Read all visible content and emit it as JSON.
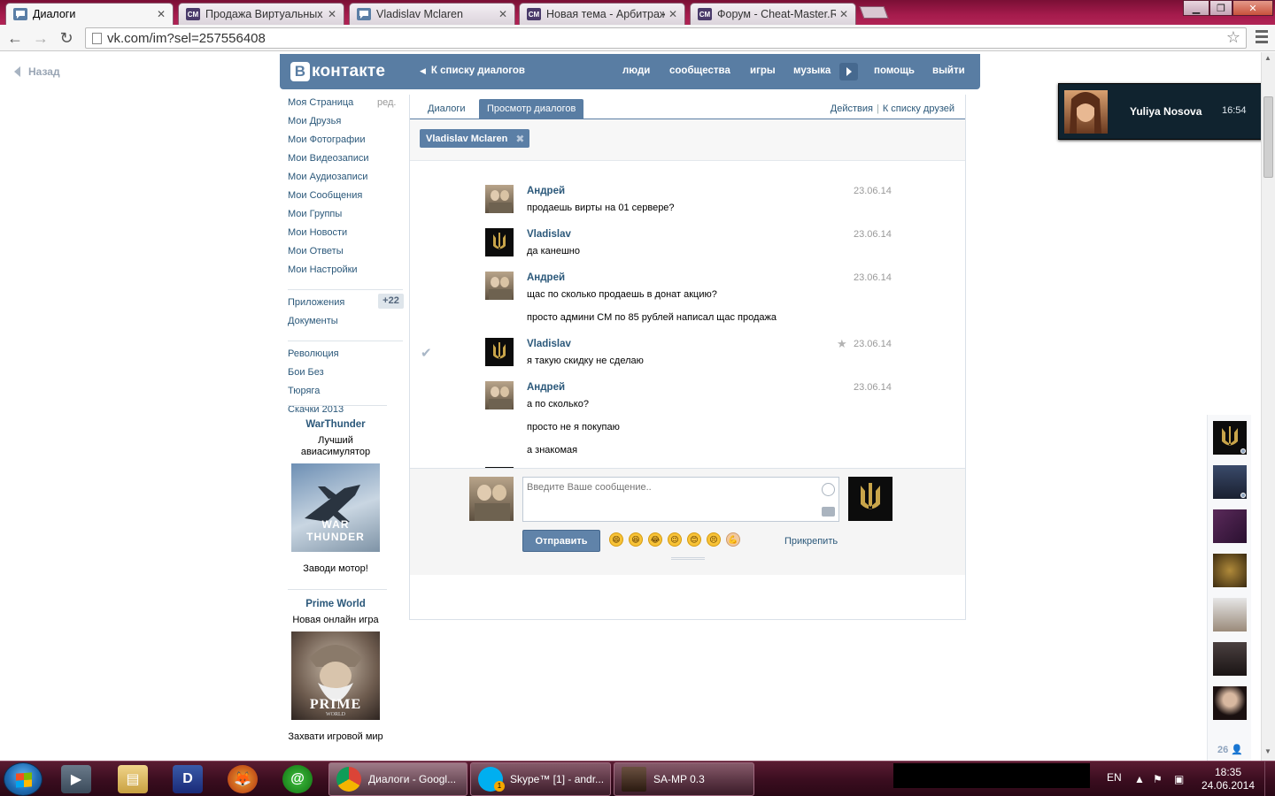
{
  "browser": {
    "tabs": [
      {
        "label": "Диалоги",
        "icon": "vk-icon",
        "active": true
      },
      {
        "label": "Продажа Виртуальных С",
        "icon": "cm-icon"
      },
      {
        "label": "Vladislav Mclaren",
        "icon": "vk-icon"
      },
      {
        "label": "Новая тема - Арбитраж /",
        "icon": "cm-icon"
      },
      {
        "label": "Форум - Cheat-Master.Ru",
        "icon": "cm-icon"
      }
    ],
    "cm_icon_text": "CM",
    "url": "vk.com/im?sel=257556408"
  },
  "page": {
    "back_label": "Назад",
    "header": {
      "logo_text": "контакте",
      "logo_letter": "В",
      "back_to_dialogs": "К списку диалогов",
      "nav": [
        "люди",
        "сообщества",
        "игры",
        "музыка",
        "помощь",
        "выйти"
      ]
    },
    "sidebar": {
      "items": [
        "Моя Страница",
        "Мои Друзья",
        "Мои Фотографии",
        "Мои Видеозаписи",
        "Мои Аудиозаписи",
        "Мои Сообщения",
        "Мои Группы",
        "Мои Новости",
        "Мои Ответы",
        "Мои Настройки"
      ],
      "edit_label": "ред.",
      "apps_label": "Приложения",
      "apps_count": "+22",
      "docs_label": "Документы",
      "groups": [
        "Революция",
        "Бои Без",
        "Тюряга",
        "Скачки 2013"
      ]
    },
    "ads": [
      {
        "title": "WarThunder",
        "subtitle": "Лучший авиасимулятор",
        "image_text": "WAR THUNDER",
        "footer": "Заводи мотор!"
      },
      {
        "title": "Prime World",
        "subtitle": "Новая онлайн игра",
        "image_text": "PRIME",
        "image_subtext": "WORLD",
        "footer": "Захвати игровой мир"
      }
    ],
    "dialog": {
      "tabs": [
        "Диалоги",
        "Просмотр диалогов"
      ],
      "actions": [
        "Действия",
        "К списку друзей"
      ],
      "actions_sep": "|",
      "peer_tag": "Vladislav Mclaren",
      "messages": [
        {
          "author": "Андрей",
          "date": "23.06.14",
          "lines": [
            "продаешь вирты на 01 сервере?"
          ]
        },
        {
          "author": "Vladislav",
          "date": "23.06.14",
          "lines": [
            "да канешно"
          ]
        },
        {
          "author": "Андрей",
          "date": "23.06.14",
          "lines": [
            "щас по сколько продаешь в донат акцию?",
            "просто админи СМ по 85 рублей написал щас продажа"
          ]
        },
        {
          "author": "Vladislav",
          "date": "23.06.14",
          "lines": [
            "я такую скидку не сделаю"
          ],
          "read_check": true,
          "starred": true
        },
        {
          "author": "Андрей",
          "date": "23.06.14",
          "lines": [
            "а по сколько?",
            "просто не я покупаю",
            "а знакомая"
          ]
        }
      ],
      "composer": {
        "placeholder": "Введите Ваше сообщение..",
        "send_label": "Отправить",
        "attach_label": "Прикрепить",
        "emojis": [
          "😄",
          "😆",
          "😂",
          "😉",
          "😊",
          "😣",
          "💪"
        ]
      }
    },
    "notification": {
      "name": "Yuliya Nosova",
      "time": "16:54"
    },
    "friends": {
      "count": "26"
    }
  },
  "taskbar": {
    "tasks": [
      {
        "label": "Диалоги - Googl...",
        "icon": "chrome-icon",
        "active": true
      },
      {
        "label": "Skype™ [1] - andr...",
        "icon": "skype-icon",
        "badge": "1"
      },
      {
        "label": "SA-MP 0.3",
        "icon": "samp-icon"
      }
    ],
    "lang": "EN",
    "time": "18:35",
    "date": "24.06.2014"
  },
  "colors": {
    "vk_blue": "#597da3",
    "link": "#2b587a",
    "taskbar": "#3a0d1f",
    "tabstrip": "#a51b4c"
  }
}
